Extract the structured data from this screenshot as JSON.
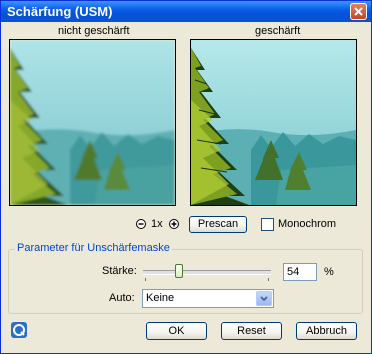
{
  "window": {
    "title": "Schärfung (USM)"
  },
  "previews": {
    "left_label": "nicht geschärft",
    "right_label": "geschärft"
  },
  "zoom": {
    "level": "1x"
  },
  "prescan_label": "Prescan",
  "monochrom": {
    "label": "Monochrom",
    "checked": false
  },
  "params": {
    "legend": "Parameter für Unschärfemaske",
    "strength_label": "Stärke:",
    "strength_value": "54",
    "strength_unit": "%",
    "strength_fraction": 0.28,
    "auto_label": "Auto:",
    "auto_value": "Keine"
  },
  "buttons": {
    "ok": "OK",
    "reset": "Reset",
    "cancel": "Abbruch"
  },
  "colors": {
    "titlebar": "#0a5fe8",
    "dialog_bg": "#ece9d8",
    "legend_text": "#0046d5"
  },
  "icons": [
    "close-icon",
    "zoom-out-icon",
    "zoom-in-icon",
    "help-icon",
    "chevron-down-icon"
  ]
}
